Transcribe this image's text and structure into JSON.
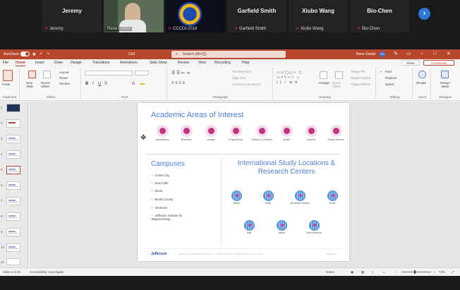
{
  "zoom": {
    "participants": [
      {
        "name": "Jeremy",
        "caption": "Jeremy",
        "big": "Jeremy"
      },
      {
        "name": "Rene Daniel",
        "caption": "Rene Daniel",
        "big": ""
      },
      {
        "name": "CCCDI-2018",
        "caption": "CCCDI-2018",
        "big": ""
      },
      {
        "name": "Garfield Smith",
        "caption": "Garfield Smith",
        "big": "Garfield Smith"
      },
      {
        "name": "Xiubo Wang",
        "caption": "Xiubo Wang",
        "big": "Xiubo Wang"
      },
      {
        "name": "Bio-Chen",
        "caption": "Bio-Chen",
        "big": "Bio-Chen"
      }
    ],
    "next_icon": "›"
  },
  "titlebar": {
    "autosave": "AutoSave",
    "autosave_state": "On",
    "file_name": "Ch3",
    "search_placeholder": "Search (Alt+Q)",
    "user": "Rene Daniel",
    "user_initials": "RD"
  },
  "menu": {
    "tabs": [
      "File",
      "Home",
      "Insert",
      "Draw",
      "Design",
      "Transitions",
      "Animations",
      "Slide Show",
      "Review",
      "View",
      "Recording",
      "Help"
    ],
    "active": "Home",
    "share": "Share",
    "comments": "Comments"
  },
  "ribbon": {
    "groups": [
      "Clipboard",
      "Slides",
      "Font",
      "Paragraph",
      "Drawing",
      "Editing",
      "Voice",
      "Designer"
    ],
    "paste": "Paste",
    "new_slide": "New Slide",
    "reuse_slides": "Reuse Slides",
    "layout": "Layout",
    "reset": "Reset",
    "section": "Section",
    "text_direction": "Text Direction",
    "align_text": "Align Text",
    "convert_smartart": "Convert to SmartArt",
    "arrange": "Arrange",
    "quick_styles": "Quick Styles",
    "shape_fill": "Shape Fill",
    "shape_outline": "Shape Outline",
    "shape_effects": "Shape Effects",
    "find": "Find",
    "replace": "Replace",
    "select": "Select",
    "dictate": "Dictate",
    "design_ideas": "Design Ideas"
  },
  "thumbnails": [
    "1",
    "2",
    "3",
    "4",
    "5",
    "6",
    "7",
    "8",
    "9",
    "10",
    "11"
  ],
  "slide": {
    "areas_title": "Academic Areas of Interest",
    "areas": [
      "Architecture",
      "Business",
      "Design",
      "Engineering",
      "Fashion & Textiles",
      "Health",
      "Science",
      "Social Science"
    ],
    "campuses_title": "Campuses",
    "campuses": [
      "Center City",
      "East Falls",
      "Dixon",
      "Bucks County",
      "Voorhees",
      "Jefferson Institute for Bioprocessing"
    ],
    "intl_title": "International Study Locations & Research Centers",
    "locations": [
      "Africa",
      "India",
      "All-Island Ireland",
      "Israel",
      "Italy",
      "Japan",
      "Latin America"
    ],
    "logo": "Jefferson",
    "footer": "THOMAS JEFFERSON UNIVERSITY · HOME OF SIDNEY KIMMEL MEDICAL COLLEGE",
    "footer_right": "PRESENT"
  },
  "status": {
    "slide_count": "Slide 5 of 20",
    "accessibility": "Accessibility: Investigate",
    "notes": "Notes",
    "zoom": "73%"
  }
}
